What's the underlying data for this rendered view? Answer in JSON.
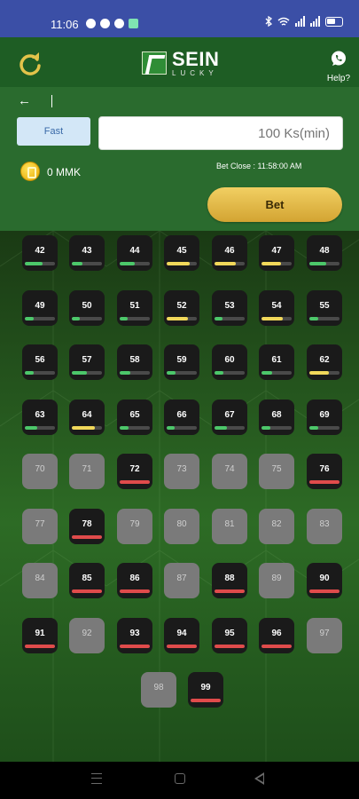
{
  "status_bar": {
    "time": "11:06",
    "battery": "61"
  },
  "header": {
    "brand_title": "SEIN",
    "brand_subtitle": "LUCKY",
    "help_label": "Help?"
  },
  "controls": {
    "back_icon": "arrow-left-icon",
    "mode_label": "Fast",
    "amount_placeholder": "100 Ks(min)",
    "balance": "0 MMK",
    "bet_close": "Bet Close : 11:58:00 AM",
    "bet_label": "Bet"
  },
  "colors": {
    "status_bar": "#3b4fa6",
    "header_bg": "#1e5d24",
    "panel_bg": "#2a6b2e",
    "bet_button": "#e1b848",
    "fill_green": "#4cc76a",
    "fill_yellow": "#f1d85a",
    "fill_red": "#e04b4b"
  },
  "numbers": [
    {
      "num": "42",
      "state": "active",
      "level": 0.6,
      "color": "green"
    },
    {
      "num": "43",
      "state": "active",
      "level": 0.35,
      "color": "green"
    },
    {
      "num": "44",
      "state": "active",
      "level": 0.5,
      "color": "green"
    },
    {
      "num": "45",
      "state": "active",
      "level": 0.75,
      "color": "yellow"
    },
    {
      "num": "46",
      "state": "active",
      "level": 0.7,
      "color": "yellow"
    },
    {
      "num": "47",
      "state": "active",
      "level": 0.65,
      "color": "yellow"
    },
    {
      "num": "48",
      "state": "active",
      "level": 0.55,
      "color": "green"
    },
    {
      "num": "49",
      "state": "active",
      "level": 0.3,
      "color": "green"
    },
    {
      "num": "50",
      "state": "active",
      "level": 0.25,
      "color": "green"
    },
    {
      "num": "51",
      "state": "active",
      "level": 0.25,
      "color": "green"
    },
    {
      "num": "52",
      "state": "active",
      "level": 0.7,
      "color": "yellow"
    },
    {
      "num": "53",
      "state": "active",
      "level": 0.25,
      "color": "green"
    },
    {
      "num": "54",
      "state": "active",
      "level": 0.7,
      "color": "yellow"
    },
    {
      "num": "55",
      "state": "active",
      "level": 0.3,
      "color": "green"
    },
    {
      "num": "56",
      "state": "active",
      "level": 0.3,
      "color": "green"
    },
    {
      "num": "57",
      "state": "active",
      "level": 0.5,
      "color": "green"
    },
    {
      "num": "58",
      "state": "active",
      "level": 0.35,
      "color": "green"
    },
    {
      "num": "59",
      "state": "active",
      "level": 0.3,
      "color": "green"
    },
    {
      "num": "60",
      "state": "active",
      "level": 0.3,
      "color": "green"
    },
    {
      "num": "61",
      "state": "active",
      "level": 0.35,
      "color": "green"
    },
    {
      "num": "62",
      "state": "active",
      "level": 0.65,
      "color": "yellow"
    },
    {
      "num": "63",
      "state": "active",
      "level": 0.4,
      "color": "green"
    },
    {
      "num": "64",
      "state": "active",
      "level": 0.75,
      "color": "yellow"
    },
    {
      "num": "65",
      "state": "active",
      "level": 0.3,
      "color": "green"
    },
    {
      "num": "66",
      "state": "active",
      "level": 0.25,
      "color": "green"
    },
    {
      "num": "67",
      "state": "active",
      "level": 0.4,
      "color": "green"
    },
    {
      "num": "68",
      "state": "active",
      "level": 0.3,
      "color": "green"
    },
    {
      "num": "69",
      "state": "active",
      "level": 0.3,
      "color": "green"
    },
    {
      "num": "70",
      "state": "closed"
    },
    {
      "num": "71",
      "state": "closed"
    },
    {
      "num": "72",
      "state": "active",
      "level": 1.0,
      "color": "red"
    },
    {
      "num": "73",
      "state": "closed"
    },
    {
      "num": "74",
      "state": "closed"
    },
    {
      "num": "75",
      "state": "closed"
    },
    {
      "num": "76",
      "state": "active",
      "level": 1.0,
      "color": "red"
    },
    {
      "num": "77",
      "state": "closed"
    },
    {
      "num": "78",
      "state": "active",
      "level": 1.0,
      "color": "red"
    },
    {
      "num": "79",
      "state": "closed"
    },
    {
      "num": "80",
      "state": "closed"
    },
    {
      "num": "81",
      "state": "closed"
    },
    {
      "num": "82",
      "state": "closed"
    },
    {
      "num": "83",
      "state": "closed"
    },
    {
      "num": "84",
      "state": "closed"
    },
    {
      "num": "85",
      "state": "active",
      "level": 1.0,
      "color": "red"
    },
    {
      "num": "86",
      "state": "active",
      "level": 1.0,
      "color": "red"
    },
    {
      "num": "87",
      "state": "closed"
    },
    {
      "num": "88",
      "state": "active",
      "level": 1.0,
      "color": "red"
    },
    {
      "num": "89",
      "state": "closed"
    },
    {
      "num": "90",
      "state": "active",
      "level": 1.0,
      "color": "red"
    },
    {
      "num": "91",
      "state": "active",
      "level": 1.0,
      "color": "red"
    },
    {
      "num": "92",
      "state": "closed"
    },
    {
      "num": "93",
      "state": "active",
      "level": 1.0,
      "color": "red"
    },
    {
      "num": "94",
      "state": "active",
      "level": 1.0,
      "color": "red"
    },
    {
      "num": "95",
      "state": "active",
      "level": 1.0,
      "color": "red"
    },
    {
      "num": "96",
      "state": "active",
      "level": 1.0,
      "color": "red"
    },
    {
      "num": "97",
      "state": "closed"
    },
    {
      "num": "98",
      "state": "closed"
    },
    {
      "num": "99",
      "state": "active",
      "level": 1.0,
      "color": "red"
    }
  ]
}
